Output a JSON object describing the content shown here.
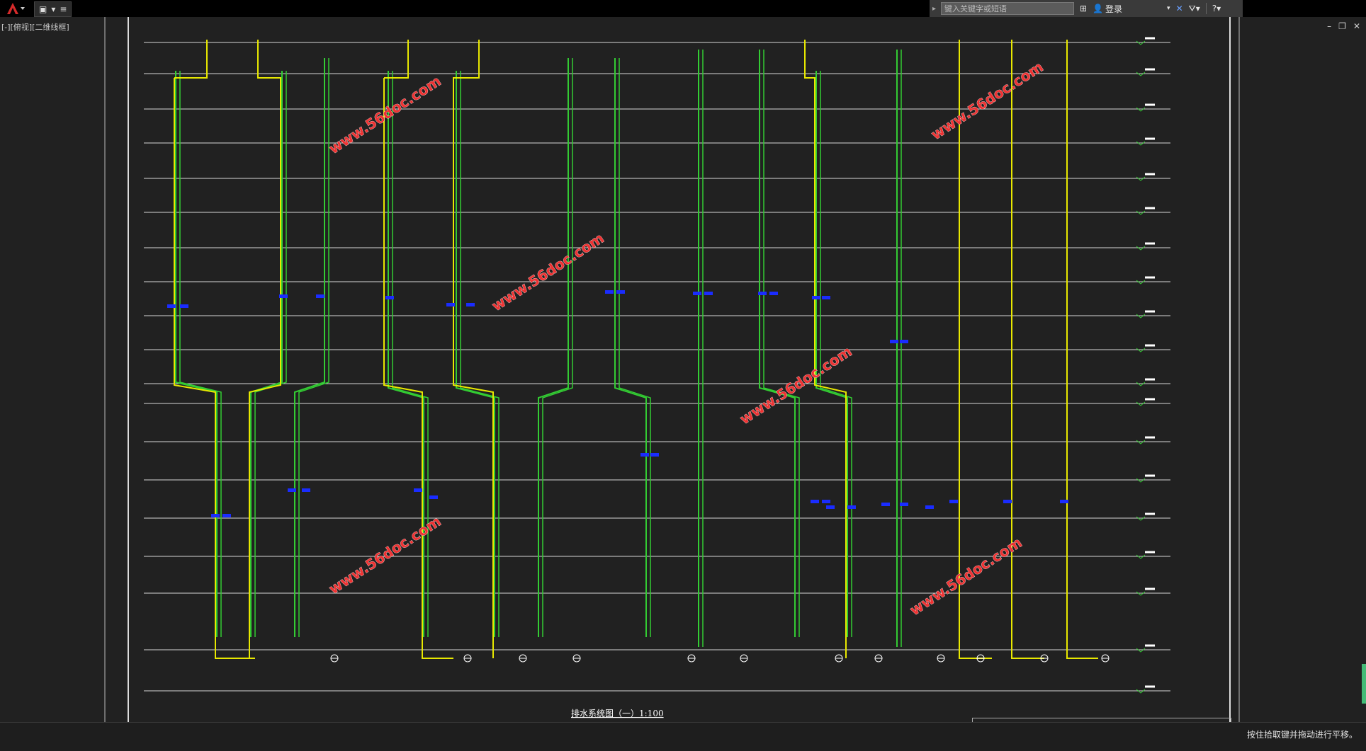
{
  "titlebar": {
    "search_placeholder": "键入关键字或短语",
    "login_label": "登录"
  },
  "viewport": {
    "label": "[-][俯视][二维线框]"
  },
  "drawing": {
    "title": "排水系统图（一）1:100",
    "watermark": "www.56doc.com"
  },
  "statusbar": {
    "message": "按住拾取键并拖动进行平移。"
  },
  "icons": {
    "app_menu": "autocad-logo-icon",
    "help": "help-icon",
    "exchange": "exchange-icon",
    "user": "user-icon",
    "binoculars": "binoculars-icon"
  },
  "colors": {
    "background": "#212121",
    "pipe_green": "#33cc33",
    "pipe_yellow": "#e8e800",
    "annotation_blue": "#1a2cff",
    "level_line": "#d8d8d8"
  }
}
